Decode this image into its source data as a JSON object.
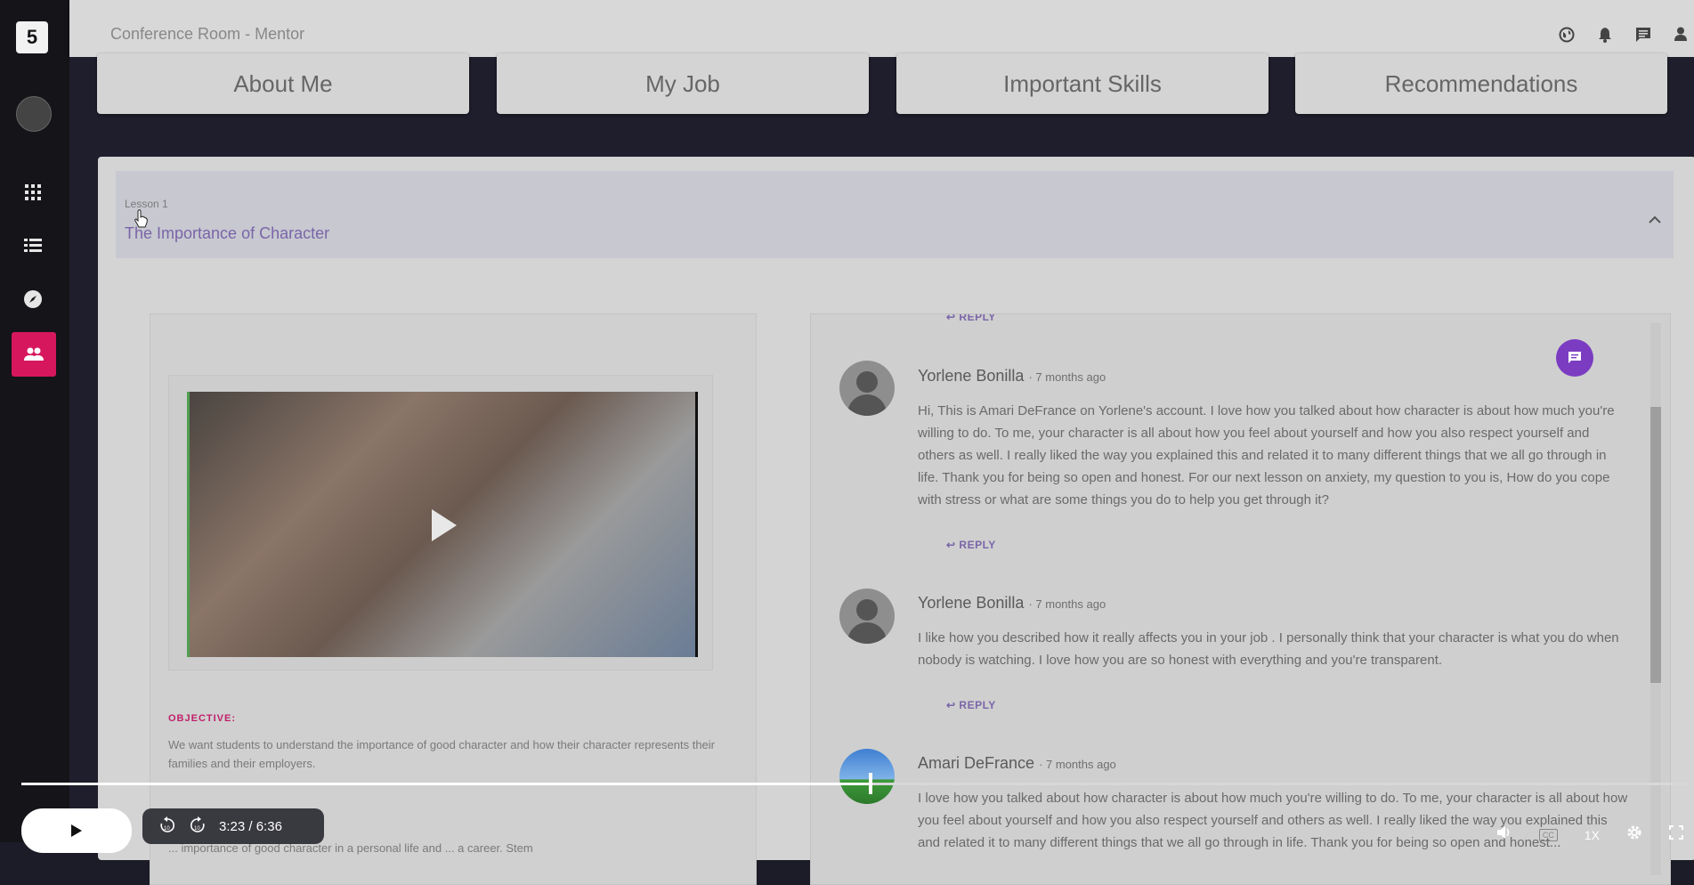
{
  "header": {
    "title": "Conference Room - Mentor"
  },
  "tabs": [
    {
      "label": "About Me"
    },
    {
      "label": "My Job"
    },
    {
      "label": "Important Skills"
    },
    {
      "label": "Recommendations"
    }
  ],
  "lesson": {
    "number": "Lesson 1",
    "title": "The Importance of Character",
    "objective_label": "OBJECTIVE:",
    "objective_text": "We want students to understand the importance of good character and how their character represents their families and their employers.",
    "more_text": "... importance of good character in a personal life and ... a career. Stem"
  },
  "comments": {
    "reply_label": "REPLY",
    "items": [
      {
        "author": "Yorlene Bonilla",
        "time": "· 7 months ago",
        "text": "Hi, This is Amari DeFrance on Yorlene's account. I love how you talked about how character is about how much you're willing to do. To me, your character is all about how you feel about yourself and how you also respect yourself and others as well. I really liked the way you explained this and related it to many different things that we all go through in life. Thank you for being so open and honest. For our next lesson on anxiety, my question to you is, How do you cope with stress or what are some things you do to help you get through it?"
      },
      {
        "author": "Yorlene Bonilla",
        "time": "· 7 months ago",
        "text": "I like how you described how it really affects you in your job . I personally think that your character is what you do when nobody is watching. I love how you are so honest with everything and you're transparent."
      },
      {
        "author": "Amari DeFrance",
        "time": "· 7 months ago",
        "text": "I love how you talked about how character is about how much you're willing to do. To me, your character is all about how you feel about yourself and how you also respect yourself and others as well. I really liked the way you explained this and related it to many different things that we all go through in life. Thank you for being so open and honest..."
      }
    ]
  },
  "player": {
    "current_time": "3:23",
    "separator": "/",
    "duration": "6:36",
    "progress_fraction": 0.51,
    "speed": "1X",
    "cc": "CC",
    "skip_back": "10",
    "skip_forward": "10"
  },
  "colors": {
    "accent_purple": "#7a65a8",
    "fab_purple": "#7b3cc2",
    "active_pink": "#d6175e",
    "objective_red": "#c0206a"
  }
}
